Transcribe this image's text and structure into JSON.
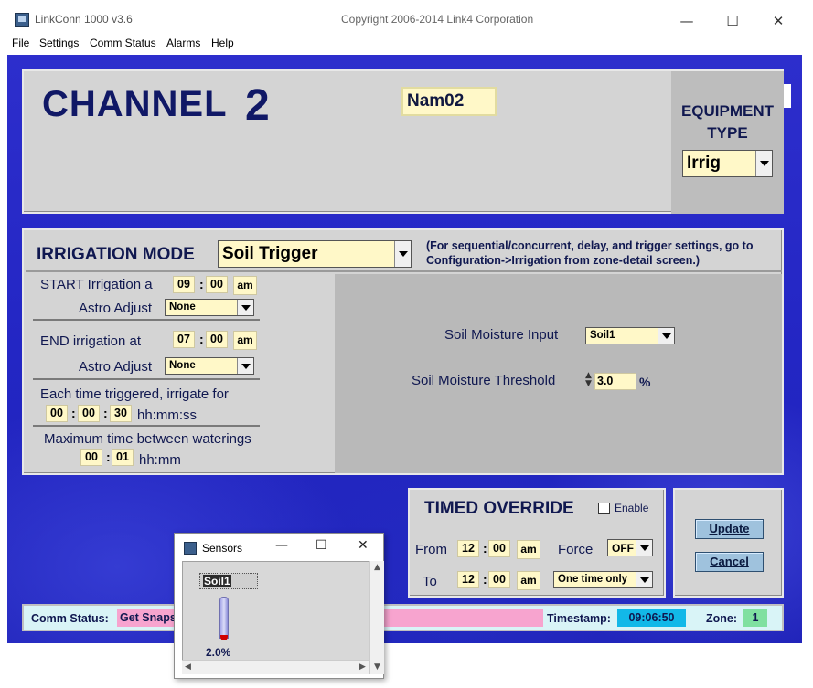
{
  "window": {
    "title": "LinkConn 1000 v3.6",
    "copyright": "Copyright 2006-2014 Link4 Corporation",
    "minimize": "—",
    "maximize": "☐",
    "close": "✕"
  },
  "menu": {
    "file": "File",
    "settings": "Settings",
    "comm_status": "Comm Status",
    "alarms": "Alarms",
    "help": "Help"
  },
  "channel": {
    "label": "CHANNEL",
    "number": "2",
    "name": "Nam02",
    "equipment_type_label": "EQUIPMENT TYPE",
    "equipment_type": "Irrig"
  },
  "irrigation": {
    "mode_label": "IRRIGATION MODE",
    "mode": "Soil Trigger",
    "note": "(For sequential/concurrent, delay, and trigger settings, go to Configuration->Irrigation from zone-detail screen.)",
    "start_label": "START Irrigation a",
    "start_hh": "09",
    "start_mm": "00",
    "start_ampm": "am",
    "start_astro_label": "Astro Adjust",
    "start_astro": "None",
    "end_label": "END irrigation at",
    "end_hh": "07",
    "end_mm": "00",
    "end_ampm": "am",
    "end_astro_label": "Astro Adjust",
    "end_astro": "None",
    "each_time_label": "Each time triggered, irrigate for",
    "each_hh": "00",
    "each_mm": "00",
    "each_ss": "30",
    "each_units": "hh:mm:ss",
    "max_time_label": "Maximum time between waterings",
    "max_hh": "00",
    "max_mm": "01",
    "max_units": "hh:mm",
    "soil_input_label": "Soil Moisture Input",
    "soil_input": "Soil1",
    "soil_threshold_label": "Soil Moisture Threshold",
    "soil_threshold": "3.0",
    "soil_threshold_unit": "%"
  },
  "override": {
    "title": "TIMED OVERRIDE",
    "enable_label": "Enable",
    "enabled": false,
    "from_label": "From",
    "from_hh": "12",
    "from_mm": "00",
    "from_ampm": "am",
    "to_label": "To",
    "to_hh": "12",
    "to_mm": "00",
    "to_ampm": "am",
    "force_label": "Force",
    "force": "OFF",
    "duration": "One time only"
  },
  "buttons": {
    "update": "Update",
    "cancel": "Cancel"
  },
  "status": {
    "comm_label": "Comm Status:",
    "comm_value": "Get Snaps",
    "timestamp_label": "Timestamp:",
    "timestamp": "09:06:50",
    "zone_label": "Zone:",
    "zone": "1"
  },
  "sensors_window": {
    "title": "Sensors",
    "sensor_name": "Soil1",
    "sensor_value": "2.0%"
  }
}
